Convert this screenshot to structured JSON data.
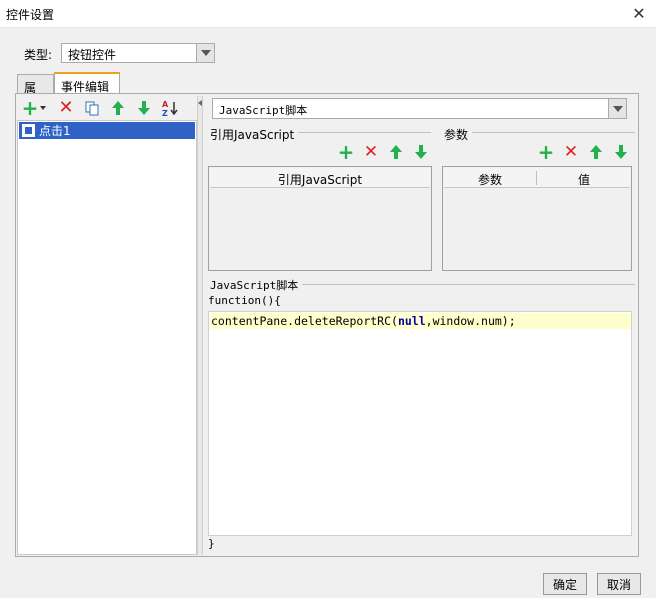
{
  "window": {
    "title": "控件设置"
  },
  "type_row": {
    "label": "类型:",
    "value": "按钮控件"
  },
  "tabs": [
    {
      "label": "属性"
    },
    {
      "label": "事件编辑"
    }
  ],
  "events": {
    "items": [
      {
        "label": "点击1"
      }
    ]
  },
  "editor": {
    "script_type": "JavaScript脚本",
    "ref_js_title": "引用JavaScript",
    "params_title": "参数",
    "ref_table": {
      "columns": [
        "引用JavaScript"
      ]
    },
    "param_table": {
      "columns": [
        "参数",
        "值"
      ]
    },
    "script_section_title": "JavaScript脚本",
    "code_prefix": "function(){",
    "code_line": {
      "part1": "contentPane.deleteReportRC(",
      "keyword": "null",
      "part2": ",window.num);"
    },
    "code_suffix": "}"
  },
  "footer": {
    "ok": "确定",
    "cancel": "取消"
  },
  "icons": {
    "close": "close-icon",
    "dropdown": "chevron-down-icon",
    "add": "plus-icon",
    "delete": "delete-x-icon",
    "copy": "copy-icon",
    "up": "arrow-up-icon",
    "down": "arrow-down-icon",
    "sort": "sort-az-icon",
    "event": "widget-event-icon"
  },
  "colors": {
    "accent_tab": "#f0a020",
    "selection": "#2f62c7",
    "add_green": "#22b14c",
    "delete_red": "#e02020",
    "code_highlight": "#ffffcc",
    "keyword": "#0000aa"
  }
}
